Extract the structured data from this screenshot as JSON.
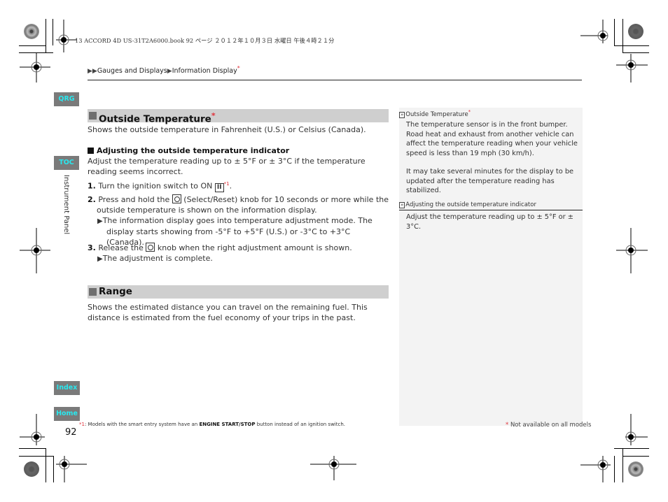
{
  "print_header": "13 ACCORD 4D US-31T2A6000.book  92 ページ  ２０１２年１０月３日  水曜日  午後４時２１分",
  "breadcrumb": {
    "arrows": "▶▶",
    "item1": "Gauges and Displays",
    "sep": "▶",
    "item2": "Information Display",
    "star": "*"
  },
  "nav_tabs": {
    "qrg": "QRG",
    "toc": "TOC",
    "index": "Index",
    "home": "Home"
  },
  "side_label": "Instrument Panel",
  "sections": {
    "outside_temp": {
      "title": "Outside Temperature",
      "star": "*",
      "intro": "Shows the outside temperature in Fahrenheit (U.S.) or Celsius (Canada).",
      "sub_heading": "Adjusting the outside temperature indicator",
      "sub_text": "Adjust the temperature reading up to ± 5°F or ± 3°C if the temperature reading seems incorrect.",
      "steps": [
        {
          "num": "1.",
          "pre": "Turn the ignition switch to ON",
          "key": "II",
          "ref": "*1",
          "post": "."
        },
        {
          "num": "2.",
          "pre": "Press and hold the",
          "post": "(Select/Reset) knob for 10 seconds or more while the",
          "line2": "outside temperature is shown on the information display.",
          "result_arrow": "▶",
          "result": "The information display goes into temperature adjustment mode. The display starts showing from -5°F to +5°F (U.S.) or -3°C to +3°C (Canada)."
        },
        {
          "num": "3.",
          "pre": "Release the",
          "post": "knob when the right adjustment amount is shown.",
          "result_arrow": "▶",
          "result": "The adjustment is complete."
        }
      ]
    },
    "range": {
      "title": "Range",
      "text": "Shows the estimated distance you can travel on the remaining fuel. This distance is estimated from the fuel economy of your trips in the past."
    }
  },
  "sidebar_notes": [
    {
      "icon": "»",
      "heading": "Outside Temperature",
      "star": "*",
      "paragraphs": [
        "The temperature sensor is in the front bumper. Road heat and exhaust from another vehicle can affect the temperature reading when your vehicle speed is less than 19 mph (30 km/h).",
        "It may take several minutes for the display to be updated after the temperature reading has stabilized."
      ]
    },
    {
      "icon": "»",
      "heading": "Adjusting the outside temperature indicator",
      "paragraphs": [
        "Adjust the temperature reading up to ± 5°F or ± 3°C."
      ]
    }
  ],
  "footnote": {
    "mark": "*1",
    "pre": ": Models with the smart entry system have an ",
    "bold": "ENGINE START/STOP",
    "post": "  button instead of an ignition switch."
  },
  "page_number": "92",
  "availability": {
    "star": "*",
    "text": "Not available on all models"
  },
  "colors": {
    "accent_red": "#e0303a",
    "tab_bg": "#7a7a7a",
    "tab_text": "#29e8ef",
    "section_bar": "#cfcfcf",
    "sidebar_bg": "#f3f3f3"
  }
}
